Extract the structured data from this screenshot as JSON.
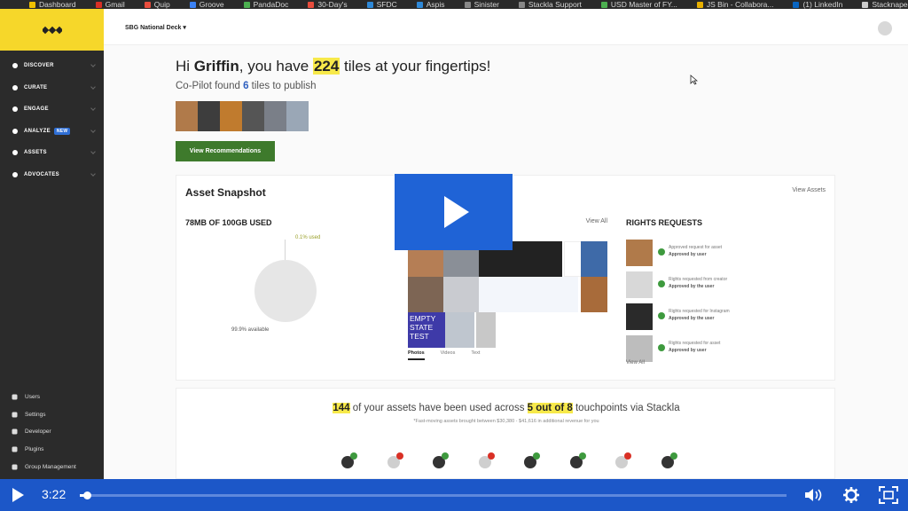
{
  "bookmarks": [
    {
      "label": "Dashboard",
      "color": "#f0c000"
    },
    {
      "label": "Gmail",
      "color": "#d93025"
    },
    {
      "label": "Quip",
      "color": "#e84d3d"
    },
    {
      "label": "Groove",
      "color": "#3b82f6"
    },
    {
      "label": "PandaDoc",
      "color": "#4caf50"
    },
    {
      "label": "30-Day's",
      "color": "#e84d3d"
    },
    {
      "label": "SFDC",
      "color": "#2f89d8"
    },
    {
      "label": "Aspis",
      "color": "#2f89d8"
    },
    {
      "label": "Sinister",
      "color": "#888888"
    },
    {
      "label": "Stackla Support",
      "color": "#888888"
    },
    {
      "label": "USD Master of FY...",
      "color": "#4caf50"
    },
    {
      "label": "JS Bin - Collabora...",
      "color": "#e8b000"
    },
    {
      "label": "(1) LinkedIn",
      "color": "#0a66c2"
    },
    {
      "label": "Stacknapedia",
      "color": "#cccccc"
    }
  ],
  "sidebar": {
    "nav": [
      {
        "label": "DISCOVER",
        "icon": "search-icon"
      },
      {
        "label": "CURATE",
        "icon": "filter-icon"
      },
      {
        "label": "ENGAGE",
        "icon": "engage-icon"
      },
      {
        "label": "ANALYZE",
        "icon": "analyze-icon",
        "badge": "NEW"
      },
      {
        "label": "ASSETS",
        "icon": "assets-icon"
      },
      {
        "label": "ADVOCATES",
        "icon": "advocates-icon"
      }
    ],
    "bottom": [
      {
        "label": "Users",
        "icon": "users-icon"
      },
      {
        "label": "Settings",
        "icon": "gear-icon"
      },
      {
        "label": "Developer",
        "icon": "developer-icon"
      },
      {
        "label": "Plugins",
        "icon": "plugins-icon"
      },
      {
        "label": "Group Management",
        "icon": "group-icon"
      }
    ]
  },
  "header": {
    "deck": "SBG National Deck ▾"
  },
  "welcome": {
    "prefix": "Hi ",
    "name": "Griffin",
    "mid": ", you have ",
    "count": "224",
    "suffix": " tiles at your fingertips!",
    "sub_prefix": "Co-Pilot found ",
    "sub_count": "6",
    "sub_suffix": " tiles to publish",
    "button": "View Recommendations"
  },
  "snapshot": {
    "title": "Asset Snapshot",
    "view_all": "View Assets",
    "storage_title": "78MB OF 100GB USED",
    "used_label": "0.1% used",
    "available_label": "99.9% available",
    "used_fraction": 0.001,
    "assets_view_all": "View All",
    "empty_state": "EMPTY STATE TEST",
    "tabs": [
      "Photos",
      "Videos",
      "Text"
    ],
    "rights_title": "RIGHTS REQUESTS",
    "rights_view_all": "View All",
    "rights": [
      {
        "line1": "Approved request for asset",
        "line2": "Approved by user"
      },
      {
        "line1": "Rights requested from creator",
        "line2": "Approved by the user"
      },
      {
        "line1": "Rights requested for Instagram",
        "line2": "Approved by the user"
      },
      {
        "line1": "Rights requested for asset",
        "line2": "Approved by user"
      }
    ]
  },
  "usage": {
    "count": "144",
    "mid": " of your assets have been used across ",
    "touch": "5 out of 8",
    "suffix": " touchpoints via Stackla",
    "note": "*Fast-moving assets brought between $30,380 - $41,616 in additional revenue for you"
  },
  "touchpoints": [
    {
      "active": true
    },
    {
      "active": false
    },
    {
      "active": true
    },
    {
      "active": false
    },
    {
      "active": true
    },
    {
      "active": true
    },
    {
      "active": false
    },
    {
      "active": true
    }
  ],
  "player": {
    "time": "3:22",
    "progress": 0.01,
    "volume_icon": "volume-icon",
    "settings_icon": "gear-icon",
    "fullscreen_icon": "fullscreen-icon"
  },
  "colors": {
    "accent": "#f6d72a",
    "sidebar": "#2b2b2b",
    "player": "#1c57c8",
    "button": "#3e7a2c"
  }
}
